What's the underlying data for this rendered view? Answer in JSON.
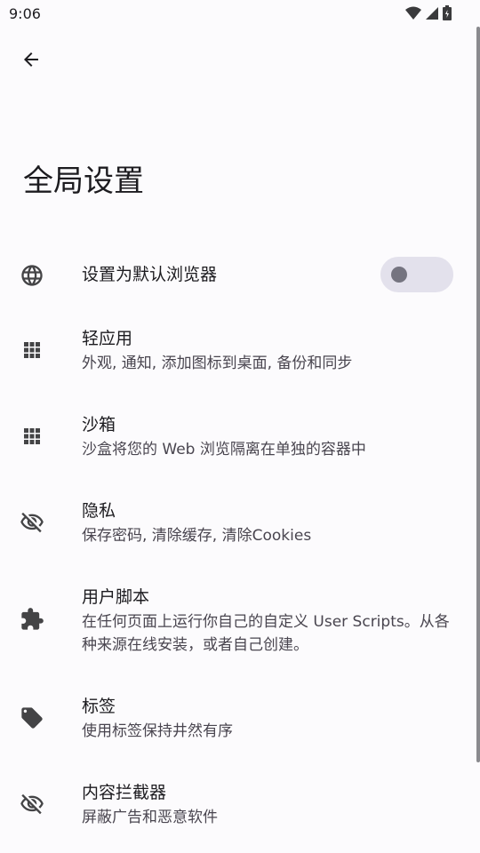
{
  "status_bar": {
    "time": "9:06"
  },
  "header": {
    "back_icon": "arrow-back-icon",
    "title": "全局设置"
  },
  "settings": [
    {
      "icon": "globe-icon",
      "title": "设置为默认浏览器",
      "subtitle": "",
      "toggle": false
    },
    {
      "icon": "apps-grid-icon",
      "title": "轻应用",
      "subtitle": "外观, 通知, 添加图标到桌面, 备份和同步"
    },
    {
      "icon": "apps-grid-icon",
      "title": "沙箱",
      "subtitle": "沙盒将您的 Web 浏览隔离在单独的容器中"
    },
    {
      "icon": "eye-off-icon",
      "title": "隐私",
      "subtitle": "保存密码, 清除缓存, 清除Cookies"
    },
    {
      "icon": "puzzle-icon",
      "title": "用户脚本",
      "subtitle": "在任何页面上运行你自己的自定义 User Scripts。从各种来源在线安装，或者自己创建。"
    },
    {
      "icon": "tag-icon",
      "title": "标签",
      "subtitle": "使用标签保持井然有序"
    },
    {
      "icon": "eye-off-icon",
      "title": "内容拦截器",
      "subtitle": "屏蔽广告和恶意软件"
    }
  ],
  "colors": {
    "background": "#fcfbfd",
    "icon": "#444446",
    "toggle_track": "#e3e1ec",
    "toggle_knob": "#757480"
  }
}
